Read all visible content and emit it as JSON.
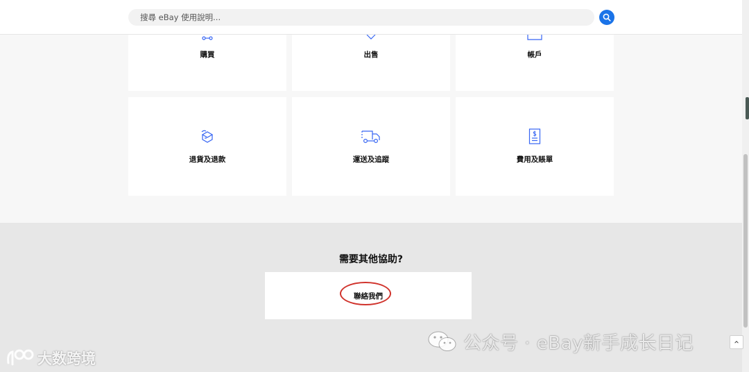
{
  "search": {
    "placeholder": "搜尋 eBay 使用說明..."
  },
  "categories": [
    {
      "label": "購買",
      "icon": "route-icon"
    },
    {
      "label": "出售",
      "icon": "tag-icon"
    },
    {
      "label": "帳戶",
      "icon": "account-card-icon"
    },
    {
      "label": "退貨及退款",
      "icon": "return-box-icon"
    },
    {
      "label": "運送及追蹤",
      "icon": "truck-icon"
    },
    {
      "label": "費用及賬單",
      "icon": "invoice-icon"
    }
  ],
  "help": {
    "title": "需要其他協助?",
    "contact_label": "聯絡我們"
  },
  "watermarks": {
    "right_text": "公众号 · eBay新手成长日记",
    "left_text": "大数跨境"
  },
  "colors": {
    "accent": "#1a73e8",
    "annotation_circle": "#d0322b",
    "page_bg": "#f7f7f7",
    "help_bg": "#e7e7e7"
  }
}
